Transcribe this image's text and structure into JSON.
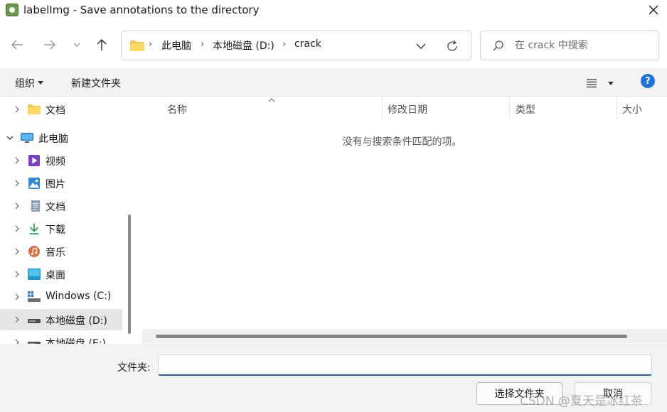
{
  "window": {
    "title": "labelImg - Save annotations to the directory",
    "close_symbol": "✕"
  },
  "navigation": {
    "back_icon": "arrow-left-icon",
    "forward_icon": "arrow-right-icon",
    "recent_icon": "chevron-down-icon",
    "up_icon": "arrow-up-icon"
  },
  "address": {
    "crumbs": [
      "此电脑",
      "本地磁盘 (D:)",
      "crack"
    ],
    "separator": "›"
  },
  "search": {
    "placeholder": "在 crack 中搜索"
  },
  "toolbar": {
    "organize_label": "组织",
    "new_folder_label": "新建文件夹",
    "help_label": "?"
  },
  "sidebar": {
    "items": [
      {
        "label": "文档",
        "icon": "folder-yellow-icon"
      },
      {
        "label": "此电脑",
        "icon": "computer-icon"
      },
      {
        "label": "视频",
        "icon": "video-icon"
      },
      {
        "label": "图片",
        "icon": "picture-icon"
      },
      {
        "label": "文档",
        "icon": "document-icon"
      },
      {
        "label": "下载",
        "icon": "download-icon"
      },
      {
        "label": "音乐",
        "icon": "music-icon"
      },
      {
        "label": "桌面",
        "icon": "desktop-icon"
      },
      {
        "label": "Windows (C:)",
        "icon": "windows-drive-icon"
      },
      {
        "label": "本地磁盘 (D:)",
        "icon": "drive-icon"
      },
      {
        "label": "本地磁盘 (E:)",
        "icon": "drive-icon"
      }
    ],
    "selected_index": 9
  },
  "content": {
    "columns": [
      "名称",
      "修改日期",
      "类型",
      "大小"
    ],
    "empty_message": "没有与搜索条件匹配的项。"
  },
  "footer": {
    "folder_label": "文件夹:",
    "folder_value": "",
    "select_button": "选择文件夹",
    "cancel_button": "取消"
  },
  "watermark": "CSDN @夏天是冰红茶",
  "colors": {
    "accent": "#1c62c4",
    "help_blue": "#1c75d6",
    "toolbar_bg": "#f3f3f3",
    "selected_bg": "#e5e5e5"
  }
}
